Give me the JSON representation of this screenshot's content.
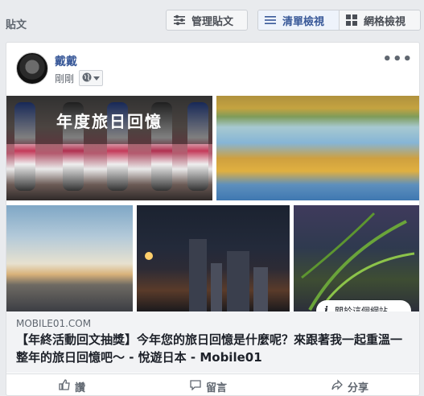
{
  "section": {
    "title": "貼文"
  },
  "toolbar": {
    "manage_label": "管理貼文",
    "list_view_label": "清單檢視",
    "grid_view_label": "網格檢視",
    "active_color": "#385898"
  },
  "post": {
    "author": "戴戴",
    "time": "剛剛",
    "more_label": "•••",
    "photo_overlay_title": "年度旅日回憶",
    "about_site_label": "關於這個網站",
    "link": {
      "domain": "MOBILE01.COM",
      "title": "【年終活動回文抽獎】今年您的旅日回憶是什麼呢？來跟著我一起重溫一整年的旅日回憶吧～ - 悅遊日本 - Mobile01"
    },
    "actions": [
      {
        "label": "讚",
        "icon": "thumbs-up-icon"
      },
      {
        "label": "留言",
        "icon": "comment-icon"
      },
      {
        "label": "分享",
        "icon": "share-icon"
      }
    ]
  }
}
